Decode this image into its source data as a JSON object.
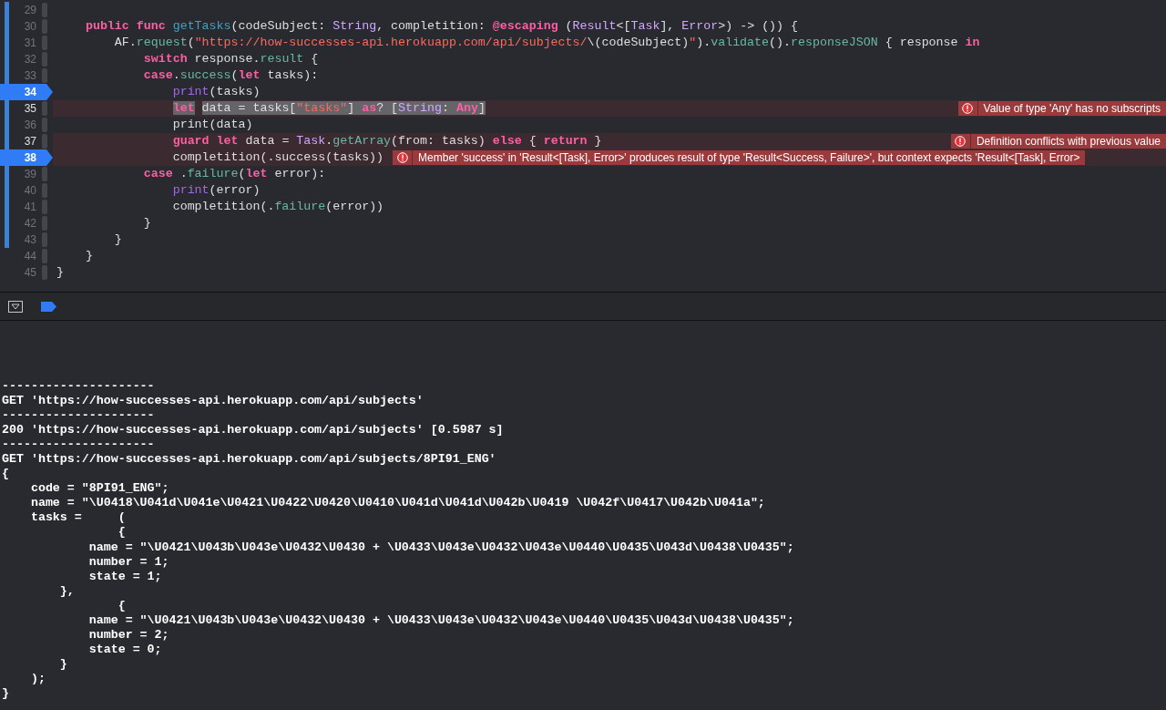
{
  "editor": {
    "lines": [
      {
        "number": "29",
        "changed": true,
        "breakpoint": false
      },
      {
        "number": "30",
        "changed": true,
        "breakpoint": false,
        "tokens": [
          {
            "kind": "keyword",
            "text": "    public"
          },
          {
            "kind": "keyword",
            "text": " func"
          },
          {
            "kind": "declaration",
            "text": " getTasks"
          },
          {
            "kind": "plain",
            "text": "(codeSubject: "
          },
          {
            "kind": "type",
            "text": "String"
          },
          {
            "kind": "plain",
            "text": ", completition: "
          },
          {
            "kind": "keyword",
            "text": "@escaping"
          },
          {
            "kind": "plain",
            "text": " ("
          },
          {
            "kind": "type",
            "text": "Result"
          },
          {
            "kind": "plain",
            "text": "<["
          },
          {
            "kind": "type",
            "text": "Task"
          },
          {
            "kind": "plain",
            "text": "], "
          },
          {
            "kind": "type",
            "text": "Error"
          },
          {
            "kind": "plain",
            "text": ">) -> ()) {"
          }
        ]
      },
      {
        "number": "31",
        "changed": true,
        "breakpoint": false,
        "tokens": [
          {
            "kind": "plain",
            "text": "        AF."
          },
          {
            "kind": "method",
            "text": "request"
          },
          {
            "kind": "plain",
            "text": "("
          },
          {
            "kind": "string",
            "text": "\"https://how-successes-api.herokuapp.com/api/subjects/"
          },
          {
            "kind": "plain",
            "text": "\\(codeSubject)"
          },
          {
            "kind": "string",
            "text": "\""
          },
          {
            "kind": "plain",
            "text": ")."
          },
          {
            "kind": "method",
            "text": "validate"
          },
          {
            "kind": "plain",
            "text": "()."
          },
          {
            "kind": "method",
            "text": "responseJSON"
          },
          {
            "kind": "plain",
            "text": " { response "
          },
          {
            "kind": "keyword",
            "text": "in"
          }
        ]
      },
      {
        "number": "32",
        "changed": true,
        "breakpoint": false,
        "tokens": [
          {
            "kind": "keyword",
            "text": "            switch"
          },
          {
            "kind": "plain",
            "text": " response."
          },
          {
            "kind": "method",
            "text": "result"
          },
          {
            "kind": "plain",
            "text": " {"
          }
        ]
      },
      {
        "number": "33",
        "changed": true,
        "breakpoint": false,
        "tokens": [
          {
            "kind": "keyword",
            "text": "            case"
          },
          {
            "kind": "plain",
            "text": "."
          },
          {
            "kind": "method",
            "text": "success"
          },
          {
            "kind": "plain",
            "text": "("
          },
          {
            "kind": "keyword",
            "text": "let"
          },
          {
            "kind": "plain",
            "text": " tasks):"
          }
        ]
      },
      {
        "number": "34",
        "changed": true,
        "breakpoint": true,
        "tokens": [
          {
            "kind": "builtin",
            "text": "                print"
          },
          {
            "kind": "plain",
            "text": "(tasks)"
          }
        ]
      },
      {
        "number": "35",
        "changed": true,
        "breakpoint": false,
        "highlighted": true,
        "tokens": [
          {
            "kind": "keyword",
            "text": "                let"
          },
          {
            "kind": "plain",
            "text": " data = tasks["
          },
          {
            "kind": "string",
            "text": "\"tasks\""
          },
          {
            "kind": "plain",
            "text": "] "
          },
          {
            "kind": "keyword",
            "text": "as"
          },
          {
            "kind": "plain",
            "text": "? ["
          },
          {
            "kind": "type",
            "text": "String"
          },
          {
            "kind": "plain",
            "text": ": "
          },
          {
            "kind": "keyword",
            "text": "Any"
          },
          {
            "kind": "plain",
            "text": "]"
          }
        ],
        "issue": {
          "kind": "right",
          "message": "Value of type 'Any' has no subscripts"
        }
      },
      {
        "number": "36",
        "changed": true,
        "breakpoint": false,
        "tokens": [
          {
            "kind": "plain",
            "text": "                print(data)"
          }
        ]
      },
      {
        "number": "37",
        "changed": true,
        "breakpoint": false,
        "tokens": [
          {
            "kind": "keyword",
            "text": "                guard"
          },
          {
            "kind": "keyword",
            "text": " let"
          },
          {
            "kind": "plain",
            "text": " data = "
          },
          {
            "kind": "type",
            "text": "Task"
          },
          {
            "kind": "plain",
            "text": "."
          },
          {
            "kind": "method",
            "text": "getArray"
          },
          {
            "kind": "plain",
            "text": "(from: tasks) "
          },
          {
            "kind": "keyword",
            "text": "else"
          },
          {
            "kind": "plain",
            "text": " { "
          },
          {
            "kind": "keyword",
            "text": "return"
          },
          {
            "kind": "plain",
            "text": " }"
          }
        ],
        "issue": {
          "kind": "right",
          "message": "Definition conflicts with previous value"
        }
      },
      {
        "number": "38",
        "changed": true,
        "breakpoint": true,
        "tokens": [
          {
            "kind": "plain",
            "text": "                completition(.success(tasks))"
          }
        ],
        "issue": {
          "kind": "inline",
          "message": "Member 'success' in 'Result<[Task], Error>' produces result of type 'Result<Success, Failure>', but context expects 'Result<[Task], Error>"
        }
      },
      {
        "number": "39",
        "changed": true,
        "breakpoint": false,
        "tokens": [
          {
            "kind": "keyword",
            "text": "            case"
          },
          {
            "kind": "plain",
            "text": " ."
          },
          {
            "kind": "method",
            "text": "failure"
          },
          {
            "kind": "plain",
            "text": "("
          },
          {
            "kind": "keyword",
            "text": "let"
          },
          {
            "kind": "plain",
            "text": " error):"
          }
        ]
      },
      {
        "number": "40",
        "changed": true,
        "breakpoint": false,
        "tokens": [
          {
            "kind": "builtin",
            "text": "                print"
          },
          {
            "kind": "plain",
            "text": "(error)"
          }
        ]
      },
      {
        "number": "41",
        "changed": true,
        "breakpoint": false,
        "tokens": [
          {
            "kind": "plain",
            "text": "                completition(."
          },
          {
            "kind": "method",
            "text": "failure"
          },
          {
            "kind": "plain",
            "text": "(error))"
          }
        ]
      },
      {
        "number": "42",
        "changed": true,
        "breakpoint": false,
        "tokens": [
          {
            "kind": "plain",
            "text": "            }"
          }
        ]
      },
      {
        "number": "43",
        "changed": true,
        "breakpoint": false,
        "tokens": [
          {
            "kind": "plain",
            "text": "        }"
          }
        ]
      },
      {
        "number": "44",
        "changed": false,
        "breakpoint": false,
        "tokens": [
          {
            "kind": "plain",
            "text": "    }"
          }
        ]
      },
      {
        "number": "45",
        "changed": false,
        "breakpoint": false,
        "tokens": [
          {
            "kind": "plain",
            "text": "}"
          }
        ]
      }
    ]
  },
  "console": {
    "lines": [
      "---------------------",
      "GET 'https://how-successes-api.herokuapp.com/api/subjects'",
      "---------------------",
      "200 'https://how-successes-api.herokuapp.com/api/subjects' [0.5987 s]",
      "---------------------",
      "GET 'https://how-successes-api.herokuapp.com/api/subjects/8PI91_ENG'",
      "{",
      "    code = \"8PI91_ENG\";",
      "    name = \"\\U0418\\U041d\\U041e\\U0421\\U0422\\U0420\\U0410\\U041d\\U041d\\U042b\\U0419 \\U042f\\U0417\\U042b\\U041a\";",
      "    tasks =     (",
      "                {",
      "            name = \"\\U0421\\U043b\\U043e\\U0432\\U0430 + \\U0433\\U043e\\U0432\\U043e\\U0440\\U0435\\U043d\\U0438\\U0435\";",
      "            number = 1;",
      "            state = 1;",
      "        },",
      "                {",
      "            name = \"\\U0421\\U043b\\U043e\\U0432\\U0430 + \\U0433\\U043e\\U0432\\U043e\\U0440\\U0435\\U043d\\U0438\\U0435\";",
      "            number = 2;",
      "            state = 0;",
      "        }",
      "    );",
      "}"
    ]
  }
}
